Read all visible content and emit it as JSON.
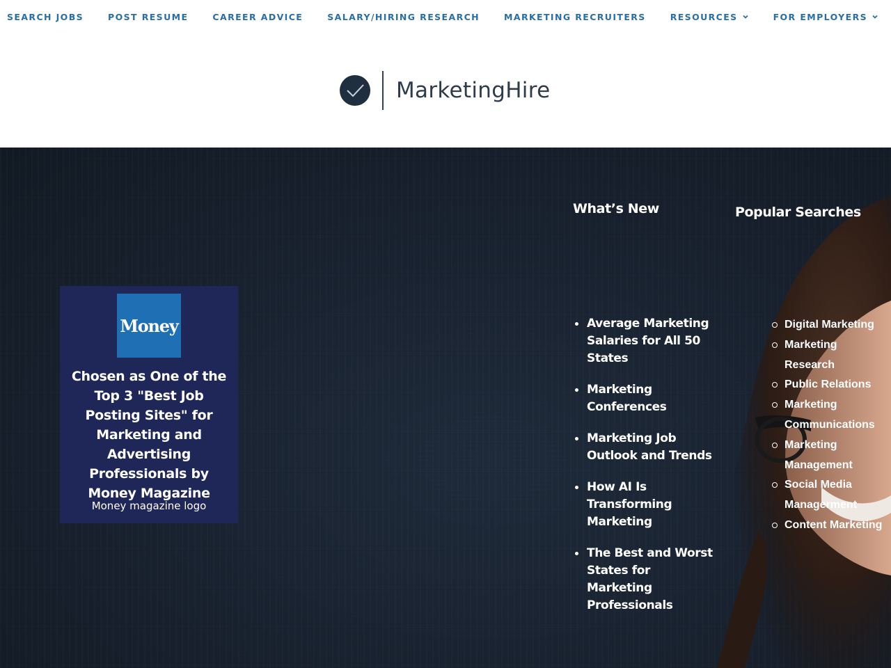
{
  "nav": {
    "items": [
      {
        "label": "SEARCH JOBS",
        "has_dropdown": false
      },
      {
        "label": "POST RESUME",
        "has_dropdown": false
      },
      {
        "label": "CAREER ADVICE",
        "has_dropdown": false
      },
      {
        "label": "SALARY/HIRING RESEARCH",
        "has_dropdown": false
      },
      {
        "label": "MARKETING RECRUITERS",
        "has_dropdown": false
      },
      {
        "label": "RESOURCES",
        "has_dropdown": true
      },
      {
        "label": "FOR EMPLOYERS",
        "has_dropdown": true
      }
    ]
  },
  "logo": {
    "text": "MarketingHire",
    "icon": "checkmark-circle-icon"
  },
  "money_card": {
    "logo_text": "Money",
    "headline": "Chosen as One of the Top 3 \"Best Job Posting Sites\" for Marketing and Advertising Professionals by Money Magazine",
    "caption": "Money magazine logo"
  },
  "whats_new": {
    "title": "What’s New",
    "items": [
      "Average Marketing Salaries for All 50 States",
      "Marketing Conferences",
      "Marketing Job Outlook and Trends",
      "How AI Is Transforming Marketing",
      "The Best and Worst States for Marketing Professionals"
    ]
  },
  "popular_searches": {
    "title": "Popular Searches",
    "items": [
      "Digital Marketing",
      "Marketing Research",
      "Public Relations",
      "Marketing Communications",
      "Marketing Management",
      "Social Media Managerment",
      "Content Marketing"
    ]
  },
  "colors": {
    "nav_text": "#2a6ea6",
    "hero_bg": "#18212e",
    "money_card_bg": "#1e2757",
    "money_logo_bg": "#1f6fb5",
    "logo_circle": "#1f2f3f"
  }
}
